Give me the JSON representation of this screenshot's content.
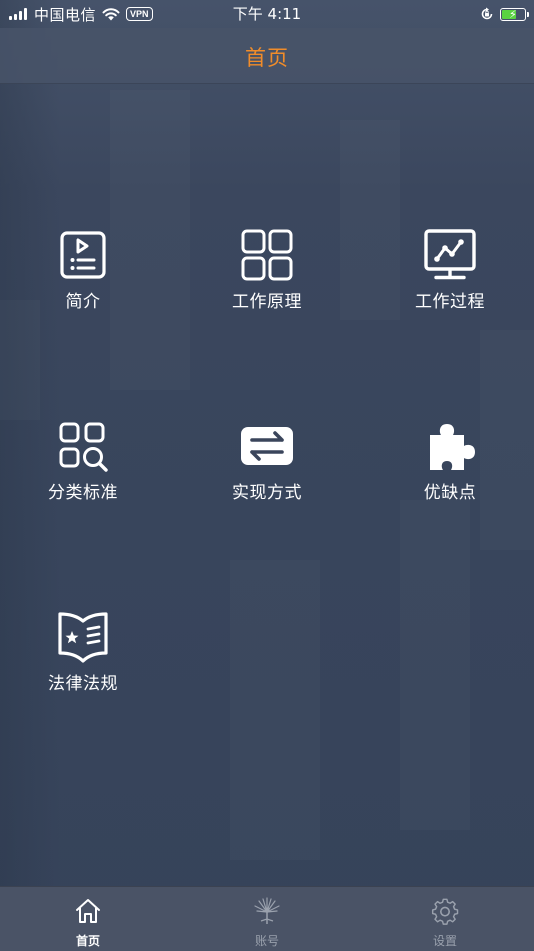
{
  "status_bar": {
    "carrier": "中国电信",
    "vpn": "VPN",
    "time": "下午 4:11",
    "battery_color": "#59d341"
  },
  "nav": {
    "title": "首页",
    "title_color": "#f08c2a"
  },
  "grid": [
    {
      "label": "简介",
      "icon": "intro-doc-icon"
    },
    {
      "label": "工作原理",
      "icon": "four-squares-icon"
    },
    {
      "label": "工作过程",
      "icon": "monitor-chart-icon"
    },
    {
      "label": "分类标准",
      "icon": "category-search-icon"
    },
    {
      "label": "实现方式",
      "icon": "swap-arrows-icon"
    },
    {
      "label": "优缺点",
      "icon": "puzzle-icon"
    },
    {
      "label": "法律法规",
      "icon": "law-book-icon"
    }
  ],
  "tabs": [
    {
      "label": "首页",
      "icon": "home-icon",
      "active": true
    },
    {
      "label": "账号",
      "icon": "account-flower-icon",
      "active": false
    },
    {
      "label": "设置",
      "icon": "gear-icon",
      "active": false
    }
  ],
  "colors": {
    "tab_active": "#ffffff",
    "tab_inactive": "#9aa1ad"
  }
}
